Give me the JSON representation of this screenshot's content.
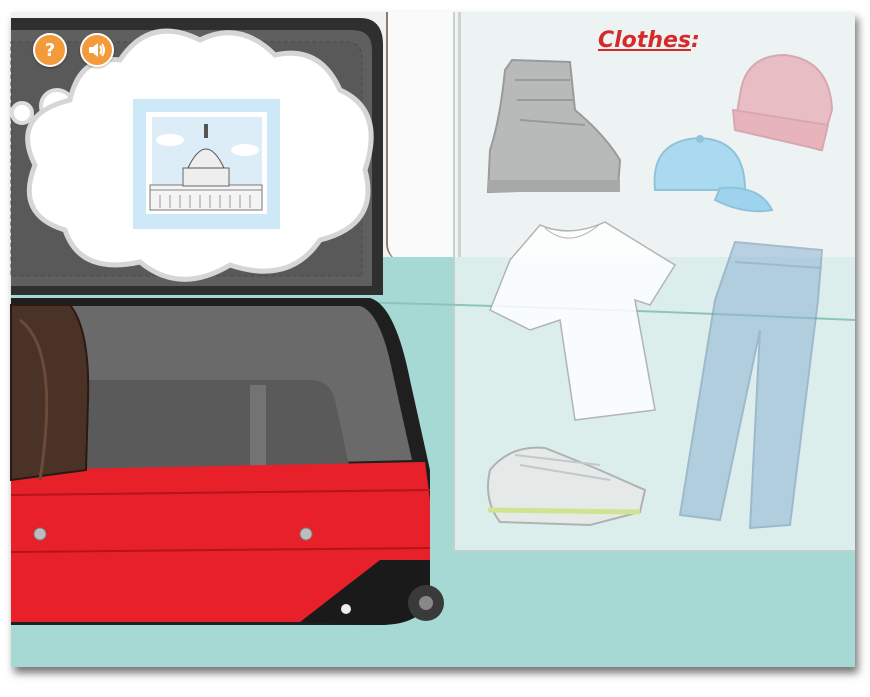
{
  "panel": {
    "title": "Clothes",
    "title_suffix": ":",
    "items": [
      {
        "name": "boot",
        "icon": "winter-boot-icon",
        "color": "#9a9a9a"
      },
      {
        "name": "beanie",
        "icon": "beanie-hat-icon",
        "color": "#e79aa6"
      },
      {
        "name": "cap",
        "icon": "baseball-cap-icon",
        "color": "#8fd0ef"
      },
      {
        "name": "tshirt",
        "icon": "t-shirt-icon",
        "color": "#ffffff"
      },
      {
        "name": "jeans",
        "icon": "jeans-icon",
        "color": "#8fb4d6"
      },
      {
        "name": "sneakers",
        "icon": "sneaker-icon",
        "color": "#dddddd"
      }
    ]
  },
  "controls": {
    "help_label": "?",
    "help_color": "#f39a3b",
    "sound_icon": "speaker-icon"
  },
  "thought_bubble": {
    "picture_icon": "capitol-building-icon",
    "frame_color": "#cde8f7"
  },
  "suitcase": {
    "color": "#e8202a",
    "lining_color": "#5e5e5e"
  }
}
